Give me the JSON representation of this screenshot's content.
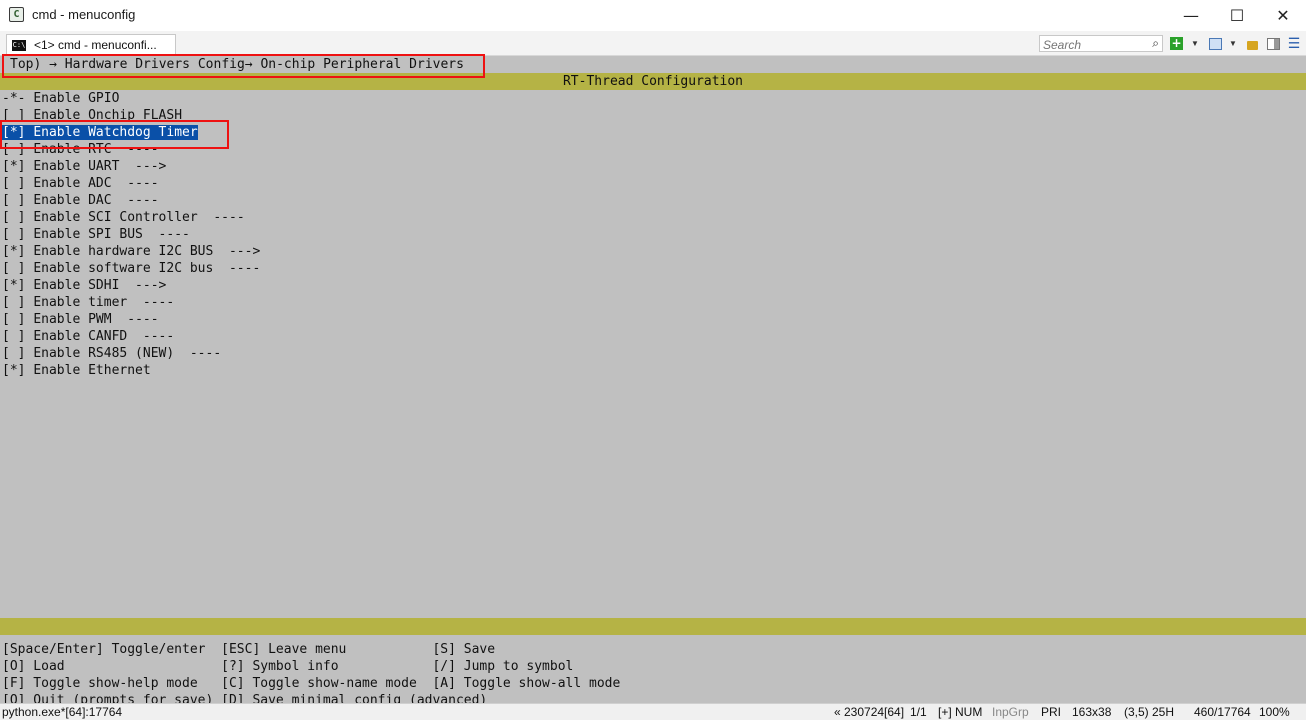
{
  "window": {
    "title": "cmd - menuconfig",
    "minimize": "—",
    "maximize": "☐",
    "close": "✕"
  },
  "tab": {
    "icon": "C:\\",
    "label": "<1> cmd - menuconfi..."
  },
  "search": {
    "placeholder": "Search"
  },
  "icons": [
    "console-icon",
    "search-icon",
    "add-icon",
    "dropdown-icon",
    "panel-icon",
    "lock-icon",
    "layout-icon",
    "menu-icon"
  ],
  "menuconfig": {
    "breadcrumb": "Top) → Hardware Drivers Config→ On-chip Peripheral Drivers",
    "header": "RT-Thread Configuration",
    "items": [
      {
        "mark": "-*-",
        "label": "Enable GPIO",
        "suffix": ""
      },
      {
        "mark": "[ ]",
        "label": "Enable Onchip FLASH",
        "suffix": ""
      },
      {
        "mark": "[*]",
        "label": "Enable Watchdog Timer",
        "suffix": ""
      },
      {
        "mark": "[ ]",
        "label": "Enable RTC",
        "suffix": "  ----"
      },
      {
        "mark": "[*]",
        "label": "Enable UART",
        "suffix": "  --->"
      },
      {
        "mark": "[ ]",
        "label": "Enable ADC",
        "suffix": "  ----"
      },
      {
        "mark": "[ ]",
        "label": "Enable DAC",
        "suffix": "  ----"
      },
      {
        "mark": "[ ]",
        "label": "Enable SCI Controller",
        "suffix": "  ----"
      },
      {
        "mark": "[ ]",
        "label": "Enable SPI BUS",
        "suffix": "  ----"
      },
      {
        "mark": "[*]",
        "label": "Enable hardware I2C BUS",
        "suffix": "  --->"
      },
      {
        "mark": "[ ]",
        "label": "Enable software I2C bus",
        "suffix": "  ----"
      },
      {
        "mark": "[*]",
        "label": "Enable SDHI",
        "suffix": "  --->"
      },
      {
        "mark": "[ ]",
        "label": "Enable timer",
        "suffix": "  ----"
      },
      {
        "mark": "[ ]",
        "label": "Enable PWM",
        "suffix": "  ----"
      },
      {
        "mark": "[ ]",
        "label": "Enable CANFD",
        "suffix": "  ----"
      },
      {
        "mark": "[ ]",
        "label": "Enable RS485 (NEW)",
        "suffix": "  ----"
      },
      {
        "mark": "[*]",
        "label": "Enable Ethernet",
        "suffix": ""
      }
    ],
    "help": [
      "[Space/Enter] Toggle/enter  [ESC] Leave menu           [S] Save",
      "[O] Load                    [?] Symbol info            [/] Jump to symbol",
      "[F] Toggle show-help mode   [C] Toggle show-name mode  [A] Toggle show-all mode",
      "[Q] Quit (prompts for save) [D] Save minimal config (advanced)"
    ]
  },
  "statusbar": {
    "process": "python.exe*[64]:17764",
    "build": "« 230724[64]",
    "pos": "1/1",
    "plus": "[+] NUM",
    "inpgrp": "InpGrp",
    "pri": "PRI",
    "size": "163x38",
    "cursor": "(3,5) 25H",
    "lines": "460/17764",
    "zoom": "100%"
  }
}
